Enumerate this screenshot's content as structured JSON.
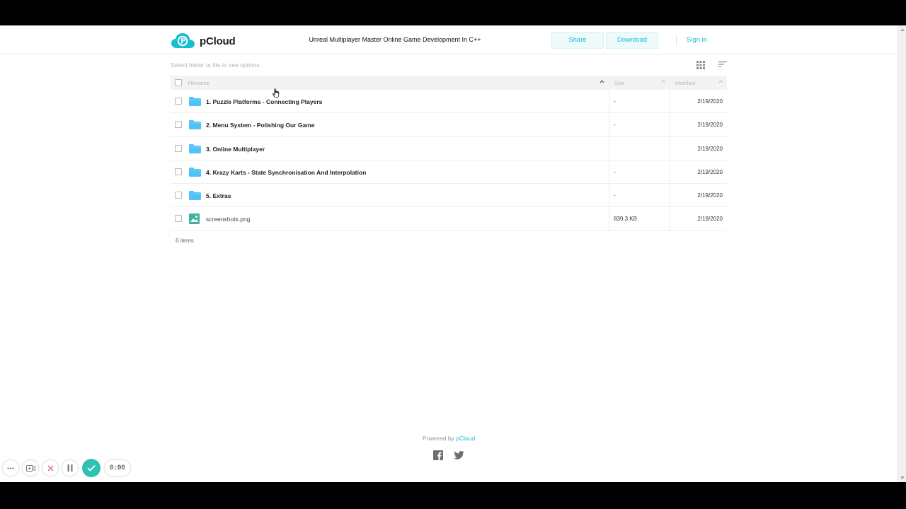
{
  "header": {
    "logo_text": "pCloud",
    "title": "Unreal Multiplayer Master Online Game Development In C++",
    "share_label": "Share",
    "download_label": "Download",
    "signin_label": "Sign in"
  },
  "toolbar": {
    "hint": "Select folder or file to see options",
    "grid_icon": "grid-view-icon",
    "sort_icon": "sort-icon"
  },
  "table": {
    "columns": {
      "filename": "Filename",
      "size": "Size",
      "modified": "Modified"
    },
    "rows": [
      {
        "name": "1. Puzzle Platforms - Connecting Players",
        "type": "folder",
        "size": "-",
        "modified": "2/19/2020"
      },
      {
        "name": "2. Menu System - Polishing Our Game",
        "type": "folder",
        "size": "-",
        "modified": "2/19/2020"
      },
      {
        "name": "3. Online Multiplayer",
        "type": "folder",
        "size": "-",
        "modified": "2/19/2020"
      },
      {
        "name": "4. Krazy Karts - State Synchronisation And Interpolation",
        "type": "folder",
        "size": "-",
        "modified": "2/19/2020"
      },
      {
        "name": "5. Extras",
        "type": "folder",
        "size": "-",
        "modified": "2/19/2020"
      },
      {
        "name": "screenshots.png",
        "type": "image",
        "size": "839.3 KB",
        "modified": "2/19/2020"
      }
    ],
    "count": "6 items"
  },
  "footer": {
    "powered_prefix": "Powered by",
    "powered_link": "pCloud"
  },
  "recorder": {
    "timer": "0:00"
  },
  "colors": {
    "accent": "#17bed0",
    "folder": "#4fc2f7",
    "image": "#3db39e",
    "recorder_check": "#2fc1b2"
  }
}
